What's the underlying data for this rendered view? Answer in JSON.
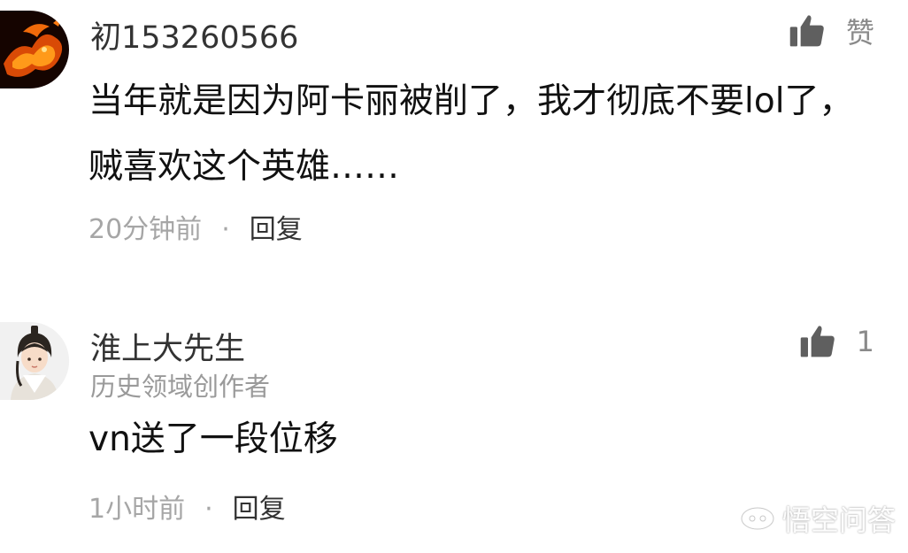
{
  "comments": [
    {
      "username": "初153260566",
      "text": "当年就是因为阿卡丽被削了，我才彻底不要lol了，贼喜欢这个英雄……",
      "time": "20分钟前",
      "separator": "·",
      "reply_label": "回复",
      "like_label": "赞",
      "like_icon": "thumbs-up-icon"
    },
    {
      "username": "淮上大先生",
      "author_tag": "历史领域创作者",
      "text": "vn送了一段位移",
      "time": "1小时前",
      "separator": "·",
      "reply_label": "回复",
      "like_count": "1",
      "like_icon": "thumbs-up-icon"
    }
  ],
  "watermark": {
    "text": "悟空问答",
    "icon": "wukong-logo-icon"
  }
}
